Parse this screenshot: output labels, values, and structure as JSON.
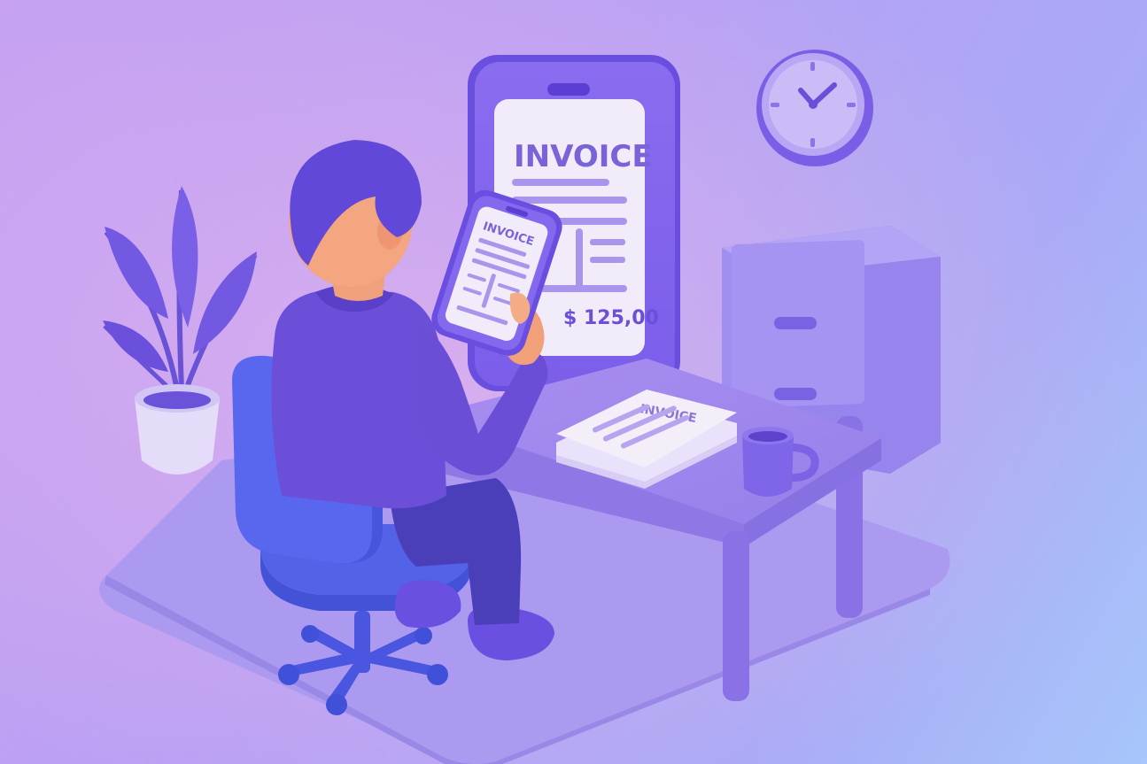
{
  "scene": {
    "big_screen": {
      "heading": "INVOICE",
      "amount": "$ 125,00"
    },
    "handheld_phone": {
      "heading": "INVOICE"
    },
    "desk_papers": {
      "heading": "INVOICE"
    }
  },
  "colors": {
    "background_light": "#c7a2f2",
    "background_blue": "#a7c6fb",
    "primary_purple": "#6b4fd8",
    "chair_blue": "#4f5ce6",
    "paper": "#f4eef9",
    "ink": "#7b68d6"
  },
  "icons": [
    "clock-icon",
    "plant-icon",
    "coffee-mug-icon",
    "chair-icon"
  ]
}
